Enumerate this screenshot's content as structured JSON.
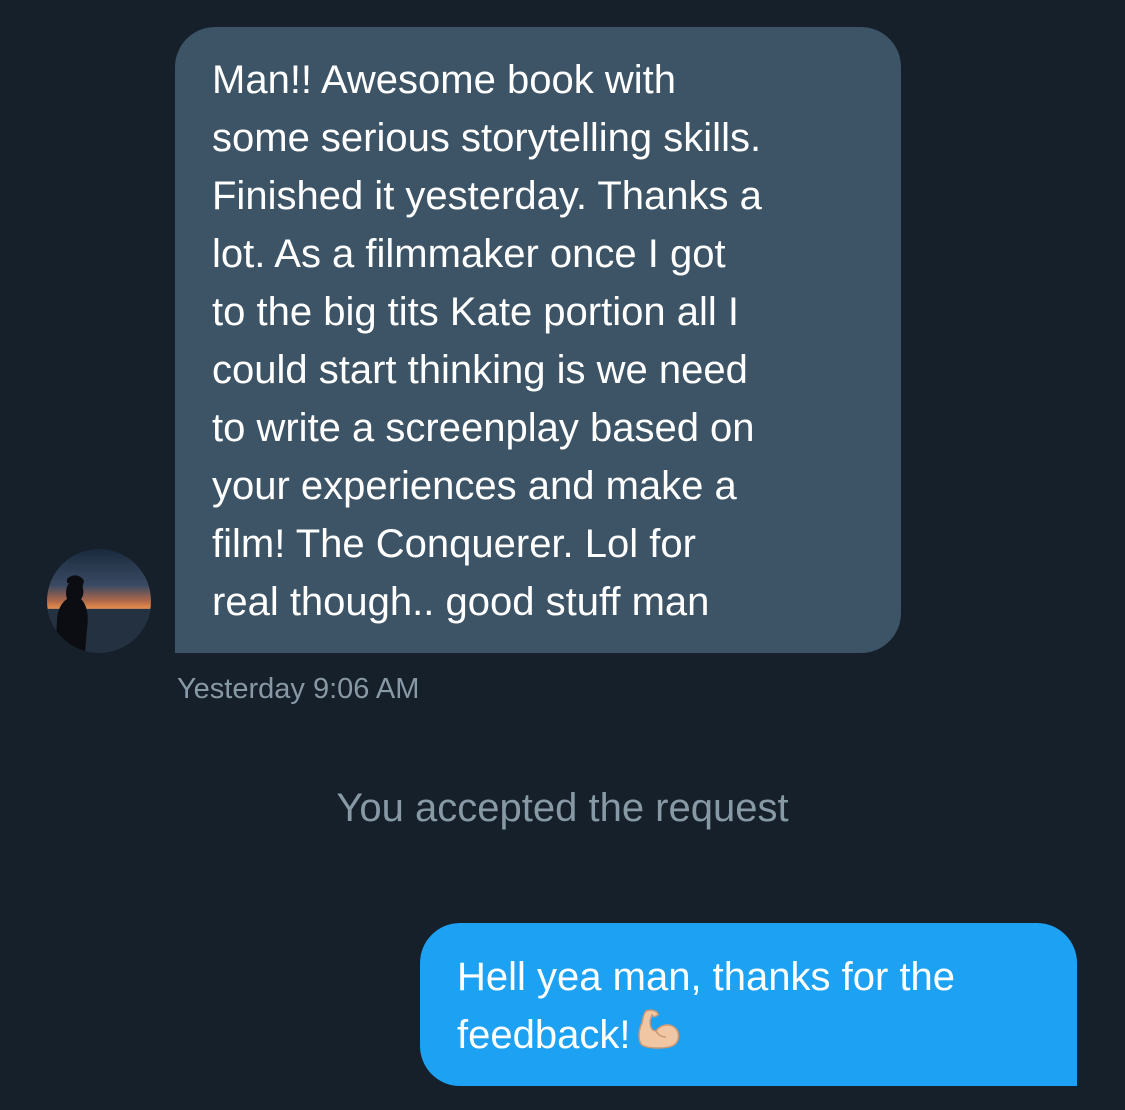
{
  "conversation": {
    "incoming": {
      "lines": [
        "Man!! Awesome book with",
        "some serious storytelling skills.",
        "Finished it yesterday. Thanks a",
        "lot. As a filmmaker once I got",
        "to the big tits Kate portion all I",
        "could start thinking is we need",
        "to write a screenplay based on",
        "your experiences and make a",
        "film! The Conquerer. Lol for",
        "real though.. good stuff man"
      ],
      "timestamp": "Yesterday 9:06 AM",
      "avatar_icon": "sunset-silhouette-avatar"
    },
    "system_notice": "You accepted the request",
    "outgoing": {
      "lines": [
        "Hell yea man, thanks for the",
        "feedback!"
      ],
      "emoji_icon": "flexed-biceps-icon"
    }
  },
  "colors": {
    "background": "#15202b",
    "incoming_bubble": "#3d5466",
    "outgoing_bubble": "#1da1f2",
    "muted_text": "#8899a6",
    "text": "#ffffff"
  }
}
